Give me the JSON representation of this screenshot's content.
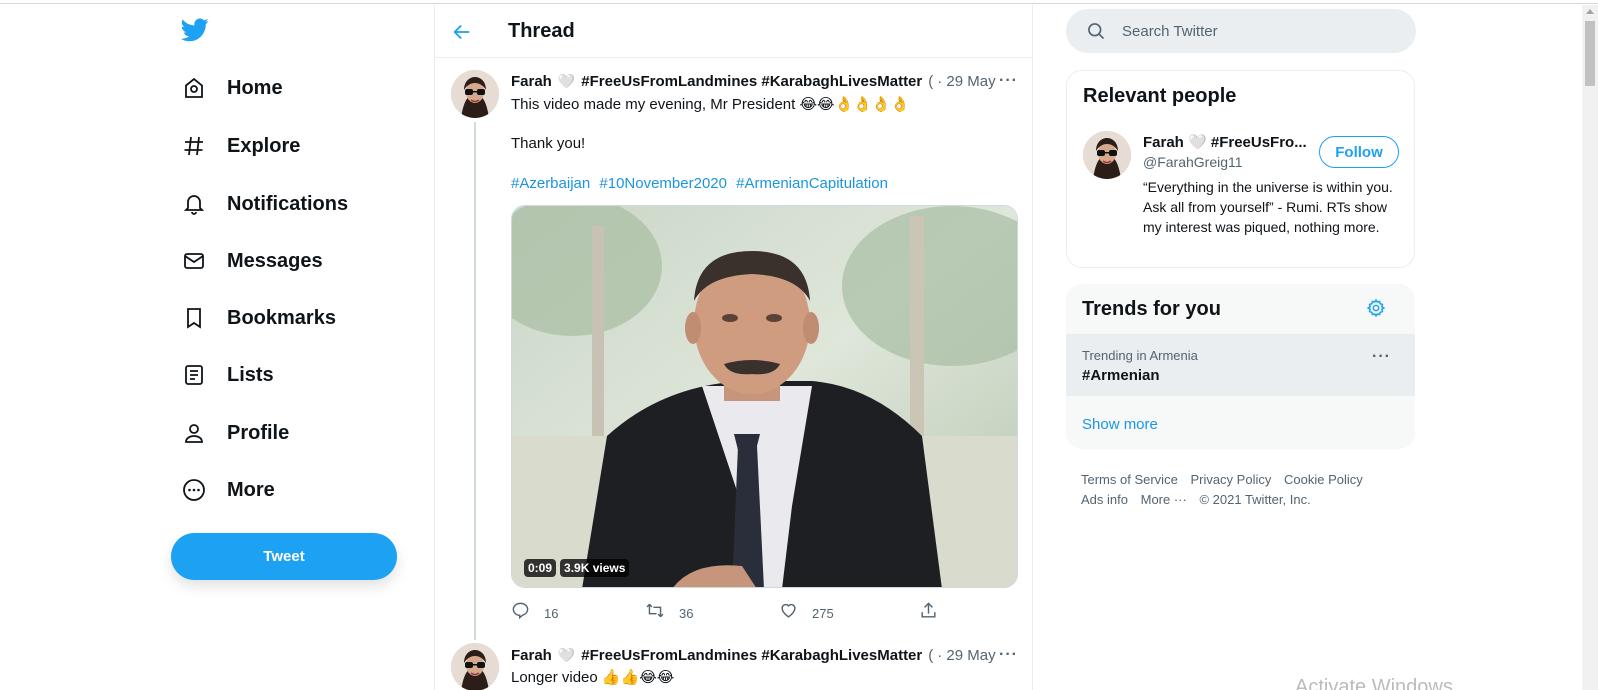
{
  "nav": {
    "items": [
      {
        "label": "Home",
        "icon": "home-icon"
      },
      {
        "label": "Explore",
        "icon": "hashtag-icon"
      },
      {
        "label": "Notifications",
        "icon": "bell-icon"
      },
      {
        "label": "Messages",
        "icon": "envelope-icon"
      },
      {
        "label": "Bookmarks",
        "icon": "bookmark-icon"
      },
      {
        "label": "Lists",
        "icon": "list-icon"
      },
      {
        "label": "Profile",
        "icon": "person-icon"
      },
      {
        "label": "More",
        "icon": "more-circle-icon"
      }
    ],
    "tweet_label": "Tweet"
  },
  "header": {
    "title": "Thread"
  },
  "tweets": [
    {
      "name": "Farah",
      "heart": "🤍",
      "tags_in_name": "#FreeUsFromLandmines #KarabaghLivesMatter",
      "ellipsis": "(",
      "date": "· 29 May",
      "line1": "This video made my evening, Mr President 😂😂👌👌👌👌",
      "line2": "Thank you!",
      "hashtags": [
        "#Azerbaijan",
        "#10November2020",
        "#ArmenianCapitulation"
      ],
      "video": {
        "duration": "0:09",
        "views": "3.9K views"
      },
      "counts": {
        "replies": "16",
        "retweets": "36",
        "likes": "275"
      }
    },
    {
      "name": "Farah",
      "heart": "🤍",
      "tags_in_name": "#FreeUsFromLandmines #KarabaghLivesMatter",
      "ellipsis": "(",
      "date": "· 29 May",
      "line1": "Longer video 👍👍😂😂"
    }
  ],
  "search": {
    "placeholder": "Search Twitter"
  },
  "relevant_people": {
    "title": "Relevant people",
    "name": "Farah 🤍 #FreeUsFro...",
    "handle": "@FarahGreig11",
    "bio": "“Everything in the universe is within you. Ask all from yourself” - Rumi. RTs show my interest was piqued, nothing more.",
    "follow_label": "Follow"
  },
  "trends": {
    "title": "Trends for you",
    "items": [
      {
        "context": "Trending in Armenia",
        "name": "#Armenian"
      }
    ],
    "show_more": "Show more"
  },
  "footer": {
    "links": [
      "Terms of Service",
      "Privacy Policy",
      "Cookie Policy",
      "Ads info",
      "More ···",
      "© 2021 Twitter, Inc."
    ]
  },
  "watermark": "Activate Windows",
  "colors": {
    "accent": "#1da1f2",
    "link": "#1b95e0",
    "text": "#0f1419",
    "muted": "#536471"
  }
}
